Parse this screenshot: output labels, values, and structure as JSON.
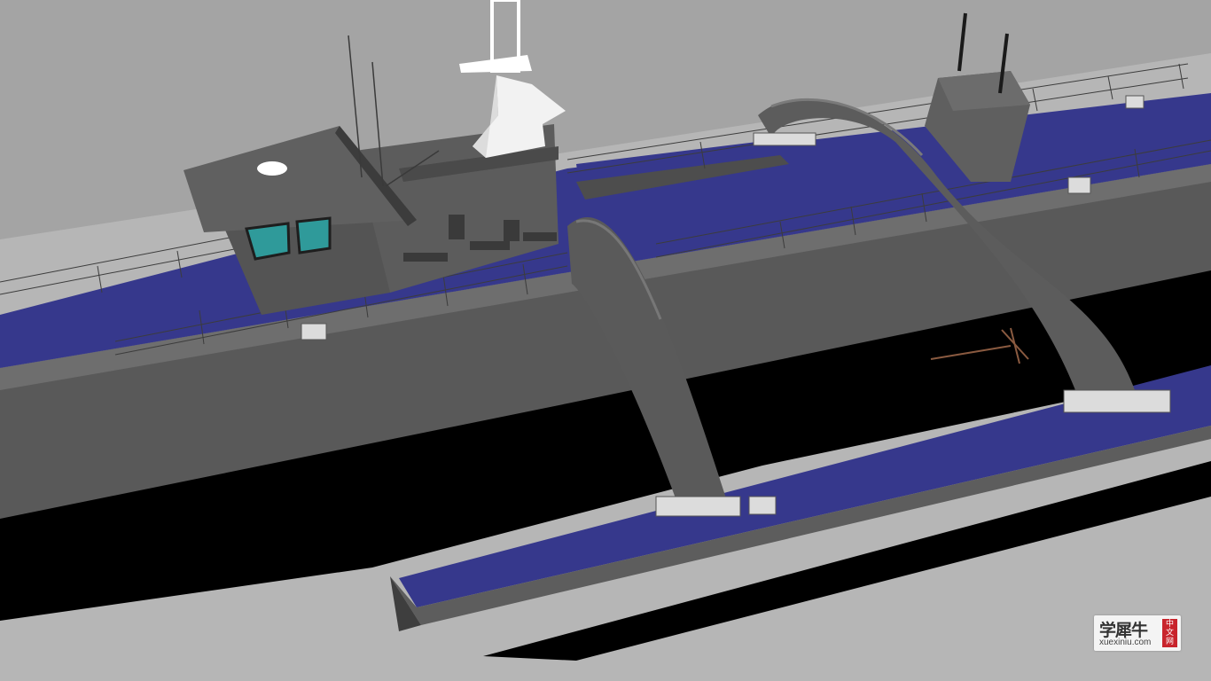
{
  "scene": {
    "subject": "trimaran-hull-ship-render",
    "colors": {
      "background": "#a3a3a3",
      "floor": "#b4b4b4",
      "hull": "#5a5a5a",
      "hull_dark": "#474747",
      "deck": "#37388c",
      "shadow": "#000000",
      "window": "#2f9a9a",
      "mast": "#ffffff"
    }
  },
  "watermark": {
    "chinese_text": "学犀牛",
    "domain": "xuexiniu.com",
    "seal_chars": "中文网"
  }
}
